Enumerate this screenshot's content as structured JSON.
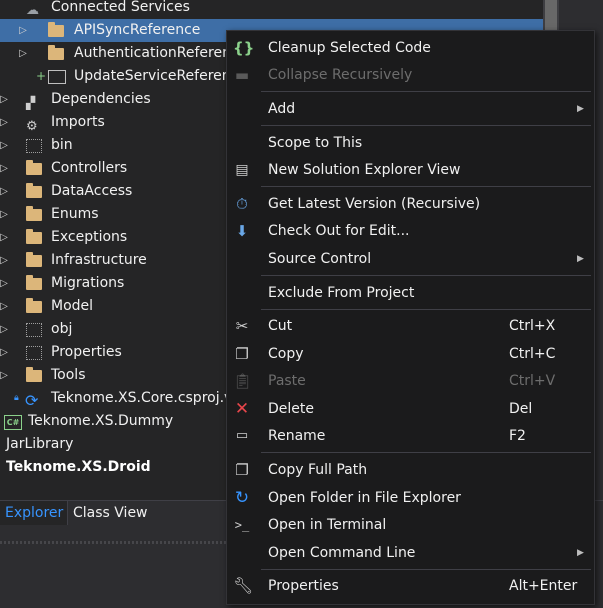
{
  "tree": {
    "items": [
      {
        "label": "Connected Services"
      },
      {
        "label": "APISyncReference"
      },
      {
        "label": "AuthenticationReference"
      },
      {
        "label": "UpdateServiceReference"
      },
      {
        "label": "Dependencies"
      },
      {
        "label": "Imports"
      },
      {
        "label": "bin"
      },
      {
        "label": "Controllers"
      },
      {
        "label": "DataAccess"
      },
      {
        "label": "Enums"
      },
      {
        "label": "Exceptions"
      },
      {
        "label": "Infrastructure"
      },
      {
        "label": "Migrations"
      },
      {
        "label": "Model"
      },
      {
        "label": "obj"
      },
      {
        "label": "Properties"
      },
      {
        "label": "Tools"
      },
      {
        "label": "Teknome.XS.Core.csproj.vs"
      },
      {
        "label": "Teknome.XS.Dummy"
      },
      {
        "label": "JarLibrary"
      },
      {
        "label": "Teknome.XS.Droid"
      }
    ],
    "csharp_badge": "C#"
  },
  "tabs": [
    {
      "label": "Explorer"
    },
    {
      "label": "Class View"
    }
  ],
  "menu": {
    "items": [
      {
        "label": "Cleanup Selected Code",
        "icon": "braces-icon"
      },
      {
        "label": "Collapse Recursively",
        "icon": "collapse-icon"
      },
      {
        "label": "Add",
        "icon": ""
      },
      {
        "label": "Scope to This",
        "icon": ""
      },
      {
        "label": "New Solution Explorer View",
        "icon": "new-window-icon"
      },
      {
        "label": "Get Latest Version (Recursive)",
        "icon": "get-latest-icon"
      },
      {
        "label": "Check Out for Edit...",
        "icon": "checkout-icon"
      },
      {
        "label": "Source Control",
        "icon": ""
      },
      {
        "label": "Exclude From Project",
        "icon": ""
      },
      {
        "label": "Cut",
        "shortcut": "Ctrl+X",
        "icon": "scissors-icon"
      },
      {
        "label": "Copy",
        "shortcut": "Ctrl+C",
        "icon": "copy-icon"
      },
      {
        "label": "Paste",
        "shortcut": "Ctrl+V",
        "icon": "paste-icon"
      },
      {
        "label": "Delete",
        "shortcut": "Del",
        "icon": "delete-icon"
      },
      {
        "label": "Rename",
        "shortcut": "F2",
        "icon": "rename-icon"
      },
      {
        "label": "Copy Full Path",
        "icon": "copy-path-icon"
      },
      {
        "label": "Open Folder in File Explorer",
        "icon": "refresh-arrow-icon"
      },
      {
        "label": "Open in Terminal",
        "icon": "terminal-icon"
      },
      {
        "label": "Open Command Line",
        "icon": ""
      },
      {
        "label": "Properties",
        "shortcut": "Alt+Enter",
        "icon": "wrench-icon"
      }
    ]
  },
  "colors": {
    "selection": "#3e6ea6",
    "menu_bg": "#1b1b1c",
    "tab_active": "#3794ff",
    "delete_red": "#e8464b",
    "braces_green": "#8bd18b"
  }
}
